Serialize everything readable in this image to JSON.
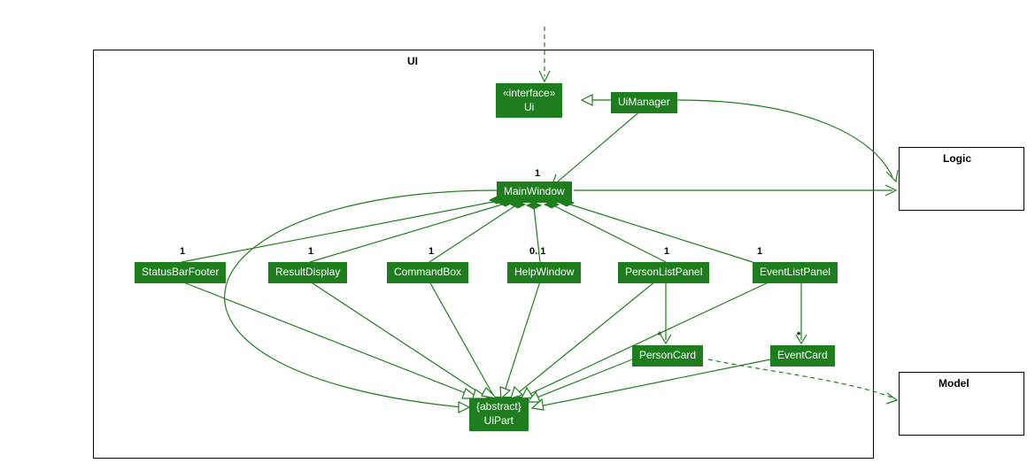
{
  "packages": {
    "ui": {
      "label": "UI"
    },
    "logic": {
      "label": "Logic"
    },
    "model": {
      "label": "Model"
    }
  },
  "classes": {
    "ui_interface": {
      "stereotype": "«interface»",
      "name": "Ui"
    },
    "ui_manager": {
      "name": "UiManager"
    },
    "main_window": {
      "name": "MainWindow"
    },
    "status_bar_footer": {
      "name": "StatusBarFooter"
    },
    "result_display": {
      "name": "ResultDisplay"
    },
    "command_box": {
      "name": "CommandBox"
    },
    "help_window": {
      "name": "HelpWindow"
    },
    "person_list_panel": {
      "name": "PersonListPanel"
    },
    "event_list_panel": {
      "name": "EventListPanel"
    },
    "person_card": {
      "name": "PersonCard"
    },
    "event_card": {
      "name": "EventCard"
    },
    "ui_part": {
      "stereotype": "{abstract}",
      "name": "UiPart"
    }
  },
  "multiplicities": {
    "main_window": "1",
    "status_bar_footer": "1",
    "result_display": "1",
    "command_box": "1",
    "help_window": "0..1",
    "person_list_panel": "1",
    "event_list_panel": "1",
    "person_card": "*",
    "event_card": "*"
  },
  "colors": {
    "class_fill": "#1e7e1e",
    "line": "#1e7e1e"
  }
}
